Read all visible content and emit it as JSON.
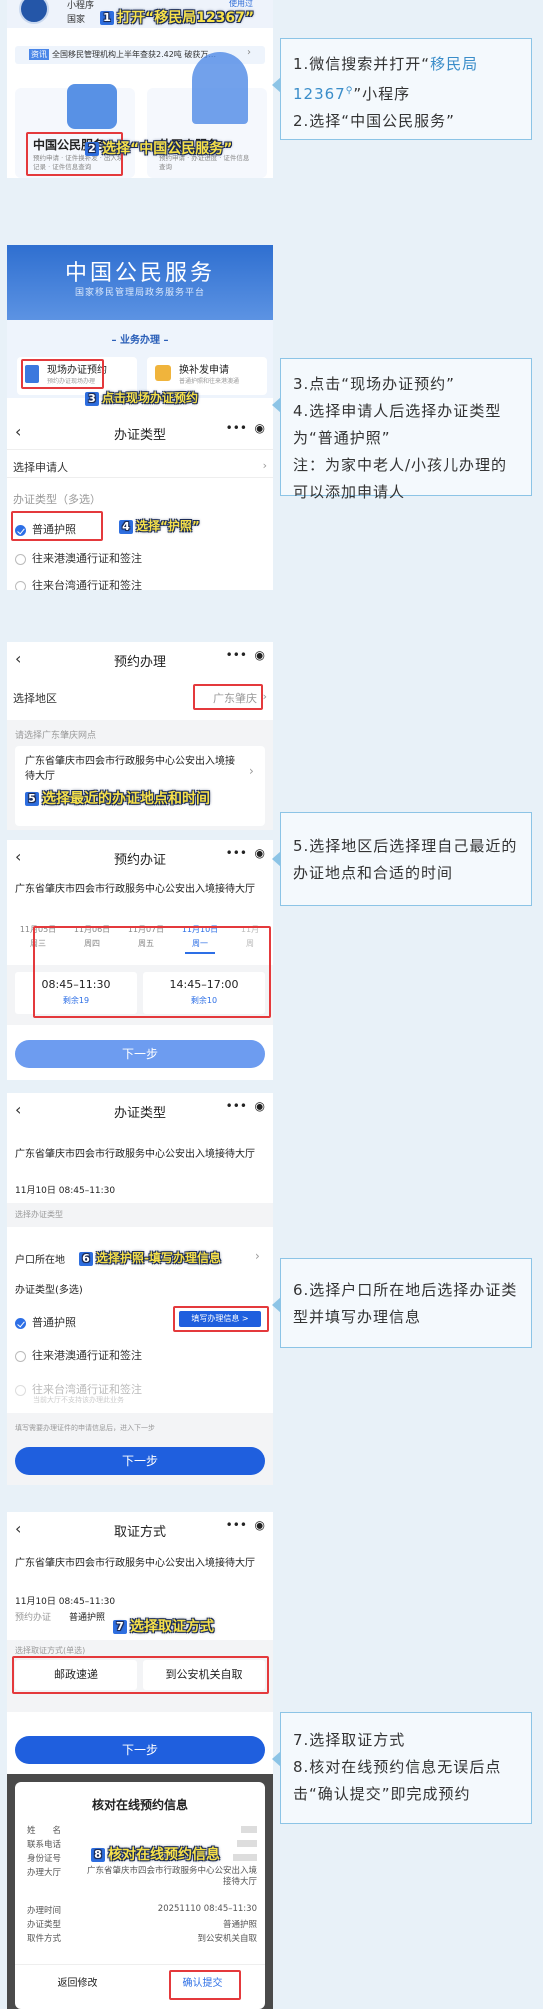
{
  "callouts": {
    "c1_line1_pre": "1.微信搜索并打开“",
    "c1_line1_hl": "移民局12367",
    "c1_line1_post": "”小程序",
    "c1_line2": "2.选择“中国公民服务”",
    "c2_line1": "3.点击“现场办证预约”",
    "c2_line2": "4.选择申请人后选择办证类型为“普通护照”",
    "c2_line3": "注：为家中老人/小孩儿办理的可以添加申请人",
    "c3_line1": "5.选择地区后选择理自己最近的办证地点和合适的时间",
    "c4_line1": "6.选择户口所在地后选择办证类型并填写办理信息",
    "c5_line1": "7.选择取证方式",
    "c5_line2": "8.核对在线预约信息无误后点击“确认提交”即完成预约"
  },
  "annotations": {
    "a1": "打开“移民局12367”",
    "a2": "选择“中国公民服务”",
    "a3": "点击现场办证预约",
    "a4": "选择“护照”",
    "a5": "选择最近的办证地点和时间",
    "a6": "选择护照-填写办理信息",
    "a7": "选择取证方式",
    "a8": "核对在线预约信息",
    "n1": "1",
    "n2": "2",
    "n3": "3",
    "n4": "4",
    "n5": "5",
    "n6": "6",
    "n7": "7",
    "n8": "8"
  },
  "s1": {
    "top_small": "小程序",
    "top_country": "国家",
    "use_label": "使用过",
    "news_tag": "资讯",
    "news_text": "全国移民管理机构上半年查获2.42吨 破获万...",
    "card1_title": "中国公民服务",
    "card1_desc": "预约申请 · 证件换补发 · 出入境记录 · 证件信息查询",
    "card2_title": "外国人服务",
    "card2_desc": "预约申请 · 办证进度 · 证件信息查询"
  },
  "s2": {
    "banner_title": "中国公民服务",
    "banner_sub": "国家移民管理局政务服务平台",
    "section_title": "– 业务办理 –",
    "btn1_title": "现场办证预约",
    "btn1_sub": "预约办证现场办理",
    "btn2_title": "换补发申请",
    "btn2_sub": "普通护照和往来港澳通",
    "nav_title": "办证类型",
    "applicant": "选择申请人",
    "type_label": "办证类型（多选）",
    "opt1": "普通护照",
    "opt2": "往来港澳通行证和签注",
    "opt3": "往来台湾通行证和签注"
  },
  "s3": {
    "nav_title": "预约办理",
    "region_label": "选择地区",
    "region_value": "广东肇庆",
    "hint": "请选择广东肇庆网点",
    "site": "广东省肇庆市四会市行政服务中心公安出入境接待大厅"
  },
  "s4": {
    "nav_title": "预约办证",
    "site": "广东省肇庆市四会市行政服务中心公安出入境接待大厅",
    "dates": [
      {
        "date": "11月05日",
        "week": "周三"
      },
      {
        "date": "11月06日",
        "week": "周四"
      },
      {
        "date": "11月07日",
        "week": "周五"
      },
      {
        "date": "11月10日",
        "week": "周一"
      },
      {
        "date": "11月",
        "week": "周"
      }
    ],
    "slot1_time": "08:45–11:30",
    "slot1_left": "剩余19",
    "slot2_time": "14:45–17:00",
    "slot2_left": "剩余10",
    "next": "下一步"
  },
  "s5": {
    "nav_title": "办证类型",
    "site": "广东省肇庆市四会市行政服务中心公安出入境接待大厅",
    "time": "11月10日 08:45–11:30",
    "type_header": "选择办证类型",
    "hukou_label": "户口所在地",
    "type_label": "办证类型(多选)",
    "opt1": "普通护照",
    "fill_btn": "填写办理信息 >",
    "opt2": "往来港澳通行证和签注",
    "opt3": "往来台湾通行证和签注",
    "opt3_sub": "当前大厅不支持该办理此业务",
    "bottom_hint": "填写需要办理证件的申请信息后，进入下一步",
    "next": "下一步"
  },
  "s6": {
    "nav_title": "取证方式",
    "site": "广东省肇庆市四会市行政服务中心公安出入境接待大厅",
    "time": "11月10日 08:45–11:30",
    "type_k": "预约办证",
    "type_v": "普通护照",
    "method_header": "选择取证方式(单选)",
    "method1": "邮政速递",
    "method2": "到公安机关自取",
    "next": "下一步"
  },
  "s7": {
    "title": "核对在线预约信息",
    "rows": [
      {
        "k": "姓　　名",
        "v": ""
      },
      {
        "k": "联系电话",
        "v": ""
      },
      {
        "k": "身份证号",
        "v": ""
      },
      {
        "k": "办理大厅",
        "v": "广东省肇庆市四会市行政服务中心公安出入境接待大厅"
      },
      {
        "k": "办理时间",
        "v": "20251110 08:45–11:30"
      },
      {
        "k": "办证类型",
        "v": "普通护照"
      },
      {
        "k": "取件方式",
        "v": "到公安机关自取"
      }
    ],
    "back": "返回修改",
    "confirm": "确认提交"
  }
}
